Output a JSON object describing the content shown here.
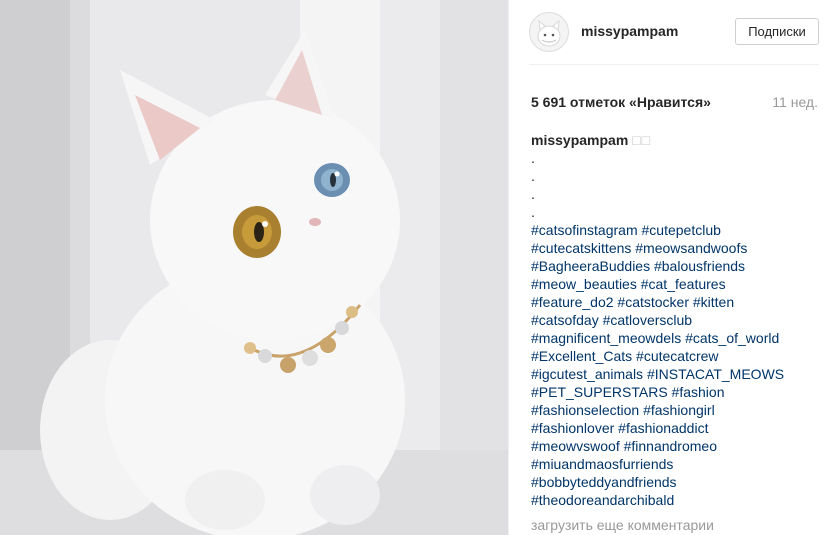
{
  "post": {
    "image_alt": "white kitten with heterochromatic eyes wearing a pearl necklace"
  },
  "header": {
    "username": "missypampam",
    "follow_label": "Подписки",
    "avatar_icon": "cat-avatar-icon"
  },
  "stats": {
    "likes": "5 691 отметок «Нравится»",
    "time_ago": "11 нед."
  },
  "caption": {
    "username": "missypampam",
    "emoji": "□□",
    "dots": [
      ".",
      ".",
      ".",
      "."
    ],
    "hashtag_lines": [
      "#catsofinstagram #cutepetclub",
      "#cutecatskittens #meowsandwoofs",
      "#BagheeraBuddies #balousfriends",
      "#meow_beauties #cat_features",
      "#feature_do2 #catstocker #kitten",
      "#catsofday #catloversclub",
      "#magnificent_meowdels #cats_of_world",
      "#Excellent_Cats #cutecatcrew",
      "#igcutest_animals #INSTACAT_MEOWS",
      "#PET_SUPERSTARS #fashion",
      "#fashionselection #fashiongirl",
      "#fashionlover #fashionaddict",
      "#meowvswoof #finnandromeo",
      "#miuandmaosfurriends",
      "#bobbyteddyandfriends",
      "#theodoreandarchibald"
    ]
  },
  "comments": {
    "load_more_label": "загрузить еще комментарии"
  },
  "colors": {
    "hashtag": "#003569",
    "muted": "#999999",
    "text": "#262626",
    "border": "#efefef"
  }
}
